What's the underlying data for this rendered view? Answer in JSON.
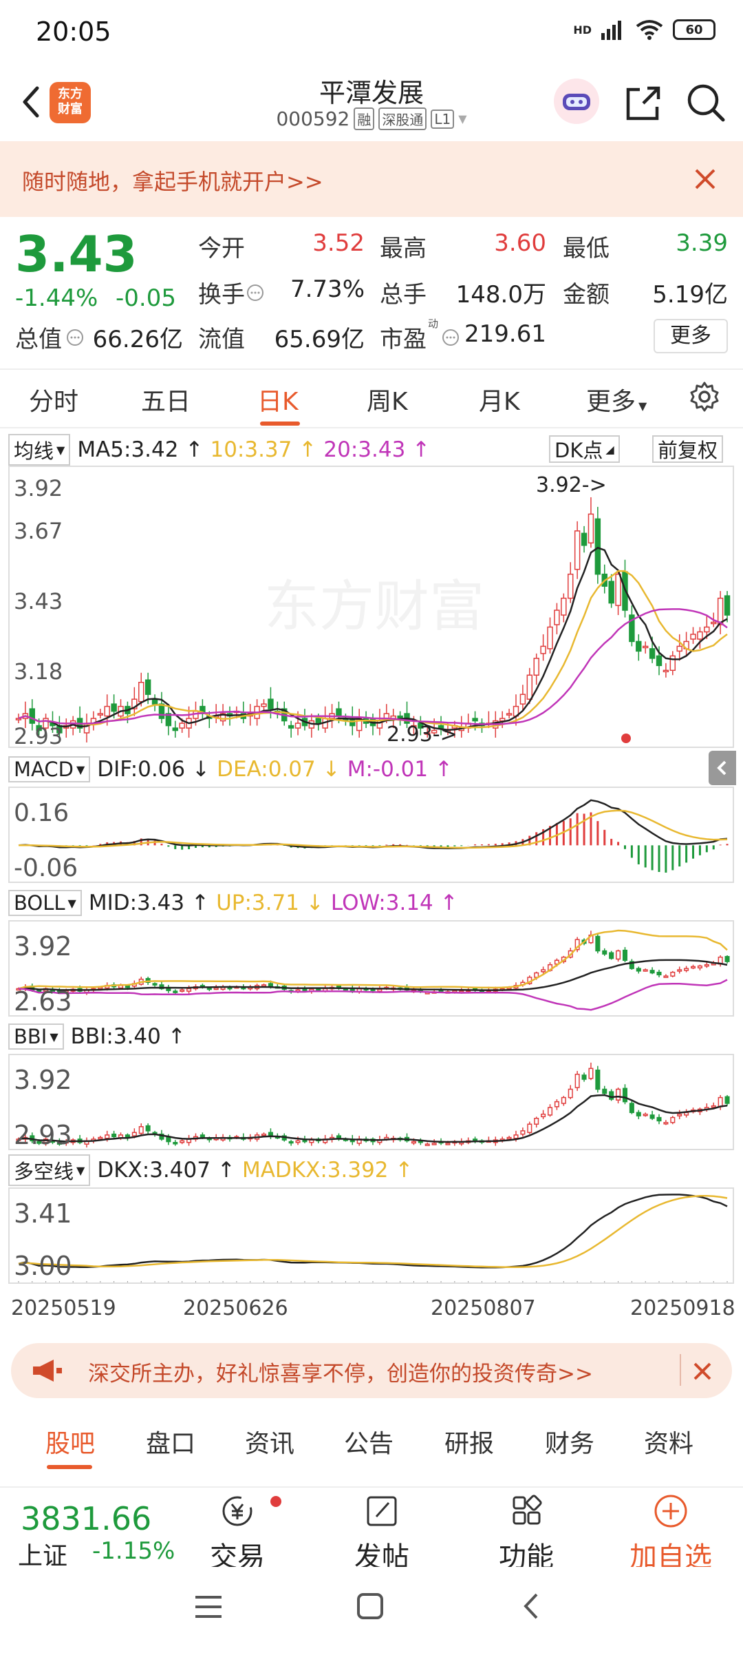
{
  "status": {
    "time": "20:05",
    "network": "HD",
    "battery": "60"
  },
  "header": {
    "logo_line1": "东方",
    "logo_line2": "财富",
    "title": "平潭发展",
    "code": "000592",
    "tags": [
      "融",
      "深股通",
      "L1"
    ]
  },
  "banner": {
    "text": "随时随地，拿起手机就开户>>"
  },
  "quote": {
    "price": "3.43",
    "pct_change": "-1.44%",
    "change": "-0.05",
    "fields": {
      "open_label": "今开",
      "open": "3.52",
      "high_label": "最高",
      "high": "3.60",
      "low_label": "最低",
      "low": "3.39",
      "turnover_label": "换手",
      "turnover": "7.73%",
      "volume_label": "总手",
      "volume": "148.0万",
      "amount_label": "金额",
      "amount": "5.19亿",
      "mcap_label": "总值",
      "mcap": "66.26亿",
      "float_label": "流值",
      "float_cap": "65.69亿",
      "pe_label": "市盈",
      "pe_sup": "动",
      "pe": "219.61"
    },
    "more_label": "更多"
  },
  "period_tabs": [
    "分时",
    "五日",
    "日K",
    "周K",
    "月K",
    "更多"
  ],
  "period_active": 2,
  "kline": {
    "selector": "均线",
    "ma5": "MA5:3.42",
    "ma10": "10:3.37",
    "ma20": "20:3.43",
    "dk_label": "DK点",
    "adjust_label": "前复权",
    "y_labels": [
      "3.92",
      "3.67",
      "3.43",
      "3.18",
      "2.93"
    ],
    "high_marker": "3.92->",
    "low_marker": "2.93->",
    "watermark": "东方财富"
  },
  "macd": {
    "selector": "MACD",
    "dif": "DIF:0.06",
    "dea": "DEA:0.07",
    "m": "M:-0.01",
    "y_labels": [
      "0.16",
      "-0.06"
    ]
  },
  "boll": {
    "selector": "BOLL",
    "mid": "MID:3.43",
    "up": "UP:3.71",
    "low": "LOW:3.14",
    "y_labels": [
      "3.92",
      "2.63"
    ]
  },
  "bbi": {
    "selector": "BBI",
    "bbi": "BBI:3.40",
    "y_labels": [
      "3.92",
      "2.93"
    ]
  },
  "dkx": {
    "selector": "多空线",
    "dkx": "DKX:3.407",
    "madkx": "MADKX:3.392",
    "y_labels": [
      "3.41",
      "3.00"
    ]
  },
  "dates": [
    "20250519",
    "20250626",
    "20250807",
    "20250918"
  ],
  "colors": {
    "up": "#e03d3d",
    "down": "#1e9a3c",
    "ma5": "#222222",
    "ma10": "#e8b830",
    "ma20": "#c035b8",
    "accent": "#e85a2c"
  },
  "promo": {
    "text": "深交所主办，好礼惊喜享不停，创造你的投资传奇>>"
  },
  "bottom_tabs": [
    "股吧",
    "盘口",
    "资讯",
    "公告",
    "研报",
    "财务",
    "资料"
  ],
  "bottom_active": 0,
  "navbar": {
    "index_value": "3831.66",
    "index_name": "上证",
    "index_pct": "-1.15%",
    "items": [
      "交易",
      "发帖",
      "功能",
      "加自选"
    ]
  },
  "chart_data": {
    "type": "candlestick",
    "period": "daily",
    "y_labels": [
      "3.92",
      "3.67",
      "3.43",
      "3.18",
      "2.93"
    ],
    "x_labels": [
      "20250519",
      "20250626",
      "20250807",
      "20250918"
    ],
    "last_close": 3.43,
    "high": 3.92,
    "low": 2.93,
    "closes": [
      3.0,
      3.02,
      2.98,
      2.95,
      3.0,
      2.97,
      2.94,
      2.97,
      2.99,
      2.96,
      2.98,
      3.0,
      3.02,
      3.05,
      3.03,
      3.05,
      3.02,
      3.08,
      3.15,
      3.1,
      3.06,
      3.0,
      2.97,
      2.95,
      2.98,
      3.0,
      3.03,
      3.02,
      3.0,
      3.01,
      3.02,
      3.01,
      3.03,
      3.0,
      3.02,
      3.05,
      3.06,
      3.04,
      3.03,
      2.99,
      2.96,
      2.98,
      2.97,
      2.99,
      2.98,
      3.0,
      3.02,
      3.01,
      2.99,
      2.97,
      3.0,
      2.98,
      2.97,
      2.99,
      3.02,
      3.01,
      3.0,
      2.98,
      2.97,
      2.96,
      2.94,
      2.95,
      2.96,
      2.95,
      2.97,
      2.96,
      2.98,
      2.99,
      2.97,
      2.98,
      2.99,
      3.0,
      3.02,
      3.05,
      3.1,
      3.18,
      3.25,
      3.3,
      3.38,
      3.45,
      3.5,
      3.6,
      3.78,
      3.72,
      3.85,
      3.6,
      3.55,
      3.48,
      3.6,
      3.45,
      3.32,
      3.28,
      3.3,
      3.25,
      3.22,
      3.2,
      3.26,
      3.3,
      3.32,
      3.35,
      3.36,
      3.38,
      3.4,
      3.5,
      3.43
    ]
  }
}
